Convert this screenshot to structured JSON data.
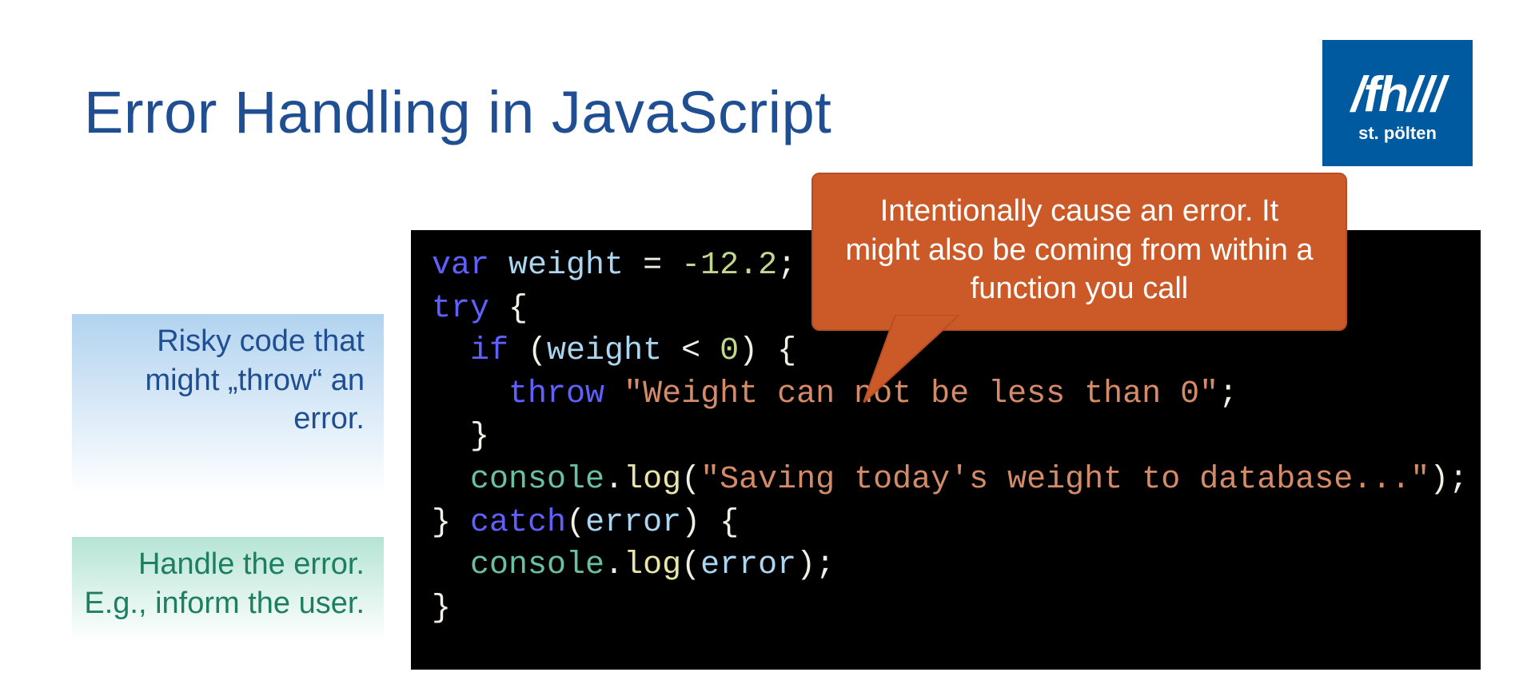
{
  "title": "Error Handling in JavaScript",
  "logo": {
    "main": "/fh///",
    "sub": "st. pölten"
  },
  "notes": {
    "try": "Risky code that might „throw“ an error.",
    "catch": "Handle the error. E.g., inform the user."
  },
  "callout": "Intentionally cause an error. It might also be coming from within a function you call",
  "code": {
    "kw_var": "var",
    "ident_weight": "weight",
    "eq": " = ",
    "num_neg": "-12.2",
    "semi": ";",
    "kw_try": "try",
    "brace_o": " {",
    "kw_if": "if",
    "paren_o": " (",
    "lt": " < ",
    "num_zero": "0",
    "paren_c_brace": ") {",
    "kw_throw": "throw",
    "str_throw": "\"Weight can not be less than 0\"",
    "brace_c": "}",
    "obj_console": "console",
    "dot": ".",
    "fn_log": "log",
    "paren_o2": "(",
    "str_save": "\"Saving today's weight to database...\"",
    "paren_c_semi": ");",
    "kw_catch": "catch",
    "ident_error": "error",
    "paren_c_brace2": ") {"
  }
}
